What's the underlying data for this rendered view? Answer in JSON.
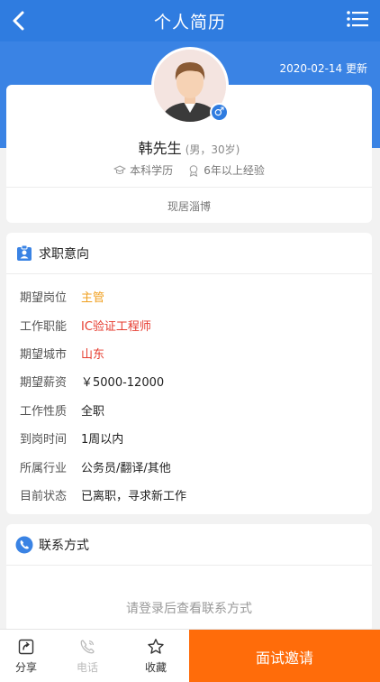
{
  "header": {
    "title": "个人简历"
  },
  "update": {
    "text": "2020-02-14 更新"
  },
  "profile": {
    "name": "韩先生",
    "meta": "(男，30岁)",
    "gender_symbol": "♂",
    "education": "本科学历",
    "experience": "6年以上经验",
    "location": "现居淄博"
  },
  "job_intent": {
    "title": "求职意向",
    "rows": [
      {
        "label": "期望岗位",
        "value": "主管"
      },
      {
        "label": "工作职能",
        "value": "IC验证工程师"
      },
      {
        "label": "期望城市",
        "value": "山东"
      },
      {
        "label": "期望薪资",
        "value": "￥5000-12000"
      },
      {
        "label": "工作性质",
        "value": "全职"
      },
      {
        "label": "到岗时间",
        "value": "1周以内"
      },
      {
        "label": "所属行业",
        "value": "公务员/翻译/其他"
      },
      {
        "label": "目前状态",
        "value": "已离职，寻求新工作"
      }
    ]
  },
  "contact": {
    "title": "联系方式",
    "message": "请登录后查看联系方式"
  },
  "bottom": {
    "share": "分享",
    "phone": "电话",
    "favorite": "收藏",
    "invite": "面试邀请"
  },
  "colors": {
    "primary": "#2f7ce0",
    "accent_orange": "#ff6c0a",
    "highlight_orange": "#f0a020",
    "highlight_red": "#e63b2e"
  }
}
